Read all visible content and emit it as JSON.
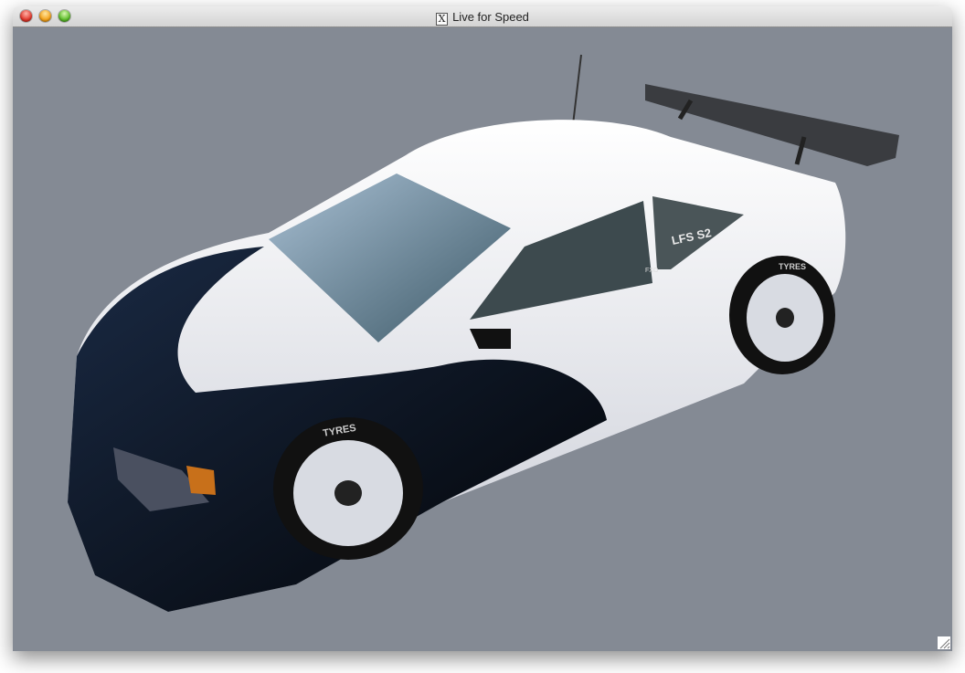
{
  "window": {
    "title": "Live for Speed",
    "title_icon": "x11-icon"
  },
  "scene": {
    "background_color": "#848a94",
    "car_decals": {
      "window": "LFS S2",
      "badge": "FXO",
      "tyre_front": "TYRES",
      "tyre_rear": "TYRES"
    }
  }
}
